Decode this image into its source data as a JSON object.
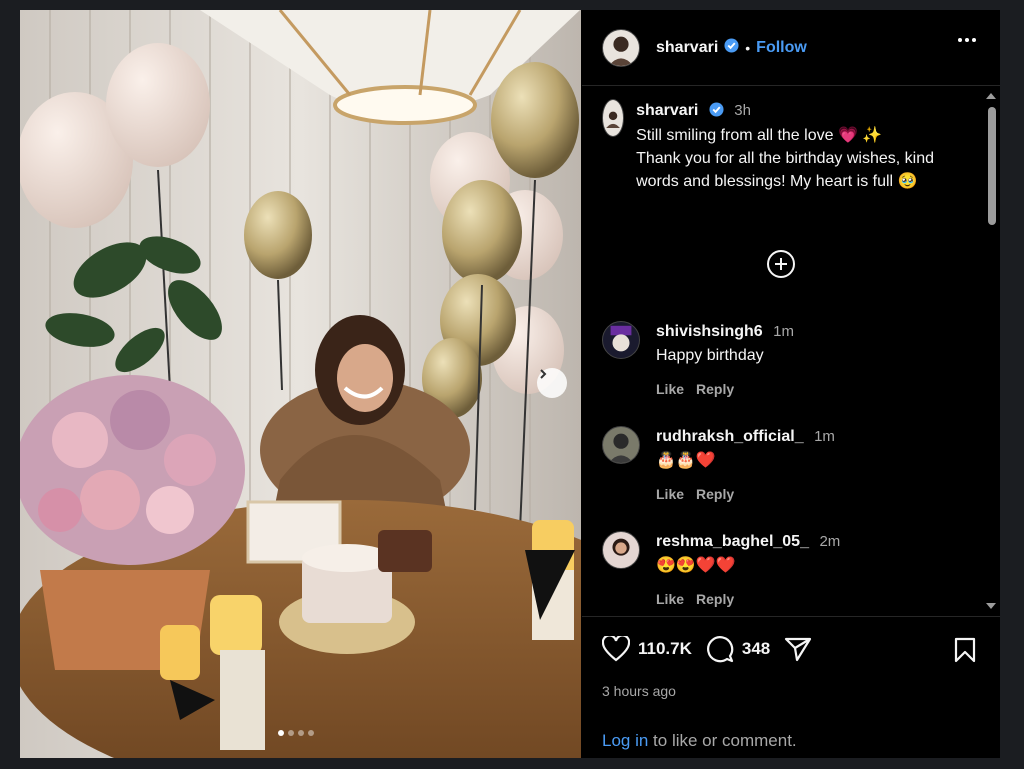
{
  "post": {
    "username": "sharvari",
    "separator": "•",
    "follow_label": "Follow",
    "caption_time": "3h",
    "caption_text": "Still smiling from all the love 💗 ✨\nThank you for all the birthday wishes, kind words and blessings! My heart is full 🥹"
  },
  "comments": [
    {
      "username": "shivishsingh6",
      "time": "1m",
      "text": "Happy birthday",
      "like_label": "Like",
      "reply_label": "Reply"
    },
    {
      "username": "rudhraksh_official_",
      "time": "1m",
      "text": "🎂🎂❤️",
      "like_label": "Like",
      "reply_label": "Reply"
    },
    {
      "username": "reshma_baghel_05_",
      "time": "2m",
      "text": "😍😍❤️❤️",
      "like_label": "Like",
      "reply_label": "Reply"
    }
  ],
  "stats": {
    "likes": "110.7K",
    "comments": "348",
    "posted": "3 hours ago"
  },
  "footer": {
    "login_label": "Log in",
    "login_suffix": " to like or comment."
  },
  "carousel": {
    "slides": 4,
    "active": 1
  },
  "icons": [
    "verified-badge-icon",
    "more-options-icon",
    "load-more-icon",
    "heart-icon",
    "comment-icon",
    "share-icon",
    "bookmark-icon",
    "chevron-right-icon"
  ],
  "colors": {
    "accent": "#4a9bf4",
    "background": "#000000",
    "muted": "#a8a8a8"
  }
}
